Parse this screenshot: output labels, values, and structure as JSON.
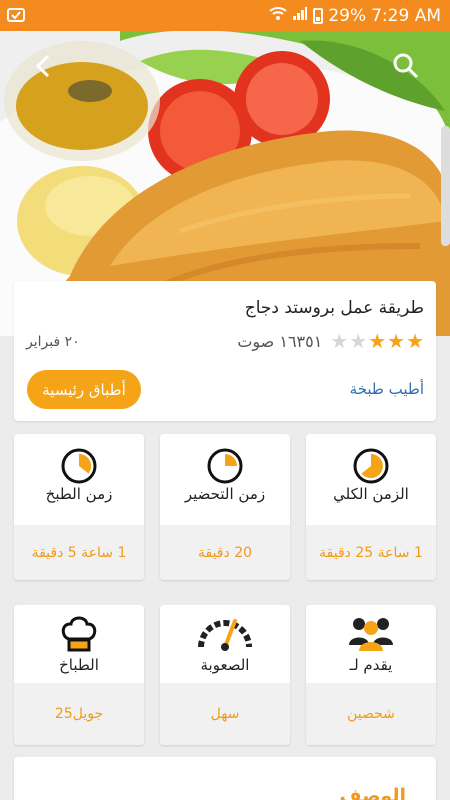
{
  "status_bar": {
    "battery": "29%",
    "time": "7:29 AM"
  },
  "recipe": {
    "title": "طريقة عمل بروستد دجاج",
    "rating": 3,
    "max_rating": 5,
    "votes": "١٦٣٥١ صوت",
    "date": "٢٠ فبراير",
    "source": "أطيب طبخة",
    "category": "أطباق رئيسية"
  },
  "stats": [
    {
      "label": "الزمن الكلي",
      "value": "1 ساعة 25 دقيقة",
      "icon": "total-time-clock-icon"
    },
    {
      "label": "زمن التحضير",
      "value": "20 دقيقة",
      "icon": "prep-time-clock-icon"
    },
    {
      "label": "زمن الطبخ",
      "value": "1 ساعة 5 دقيقة",
      "icon": "cook-time-clock-icon"
    },
    {
      "label": "يقدم لـ",
      "value": "شحصين",
      "icon": "people-icon"
    },
    {
      "label": "الصعوبة",
      "value": "سهل",
      "icon": "gauge-icon"
    },
    {
      "label": "الطباخ",
      "value": "جويل25",
      "icon": "chef-hat-icon"
    }
  ],
  "description": {
    "title": "الوصف"
  },
  "colors": {
    "accent": "#f6a417",
    "status_bar": "#f48b1f",
    "link": "#2d6fb6",
    "star_on": "#f6a417",
    "star_off": "#d6d6d6"
  }
}
